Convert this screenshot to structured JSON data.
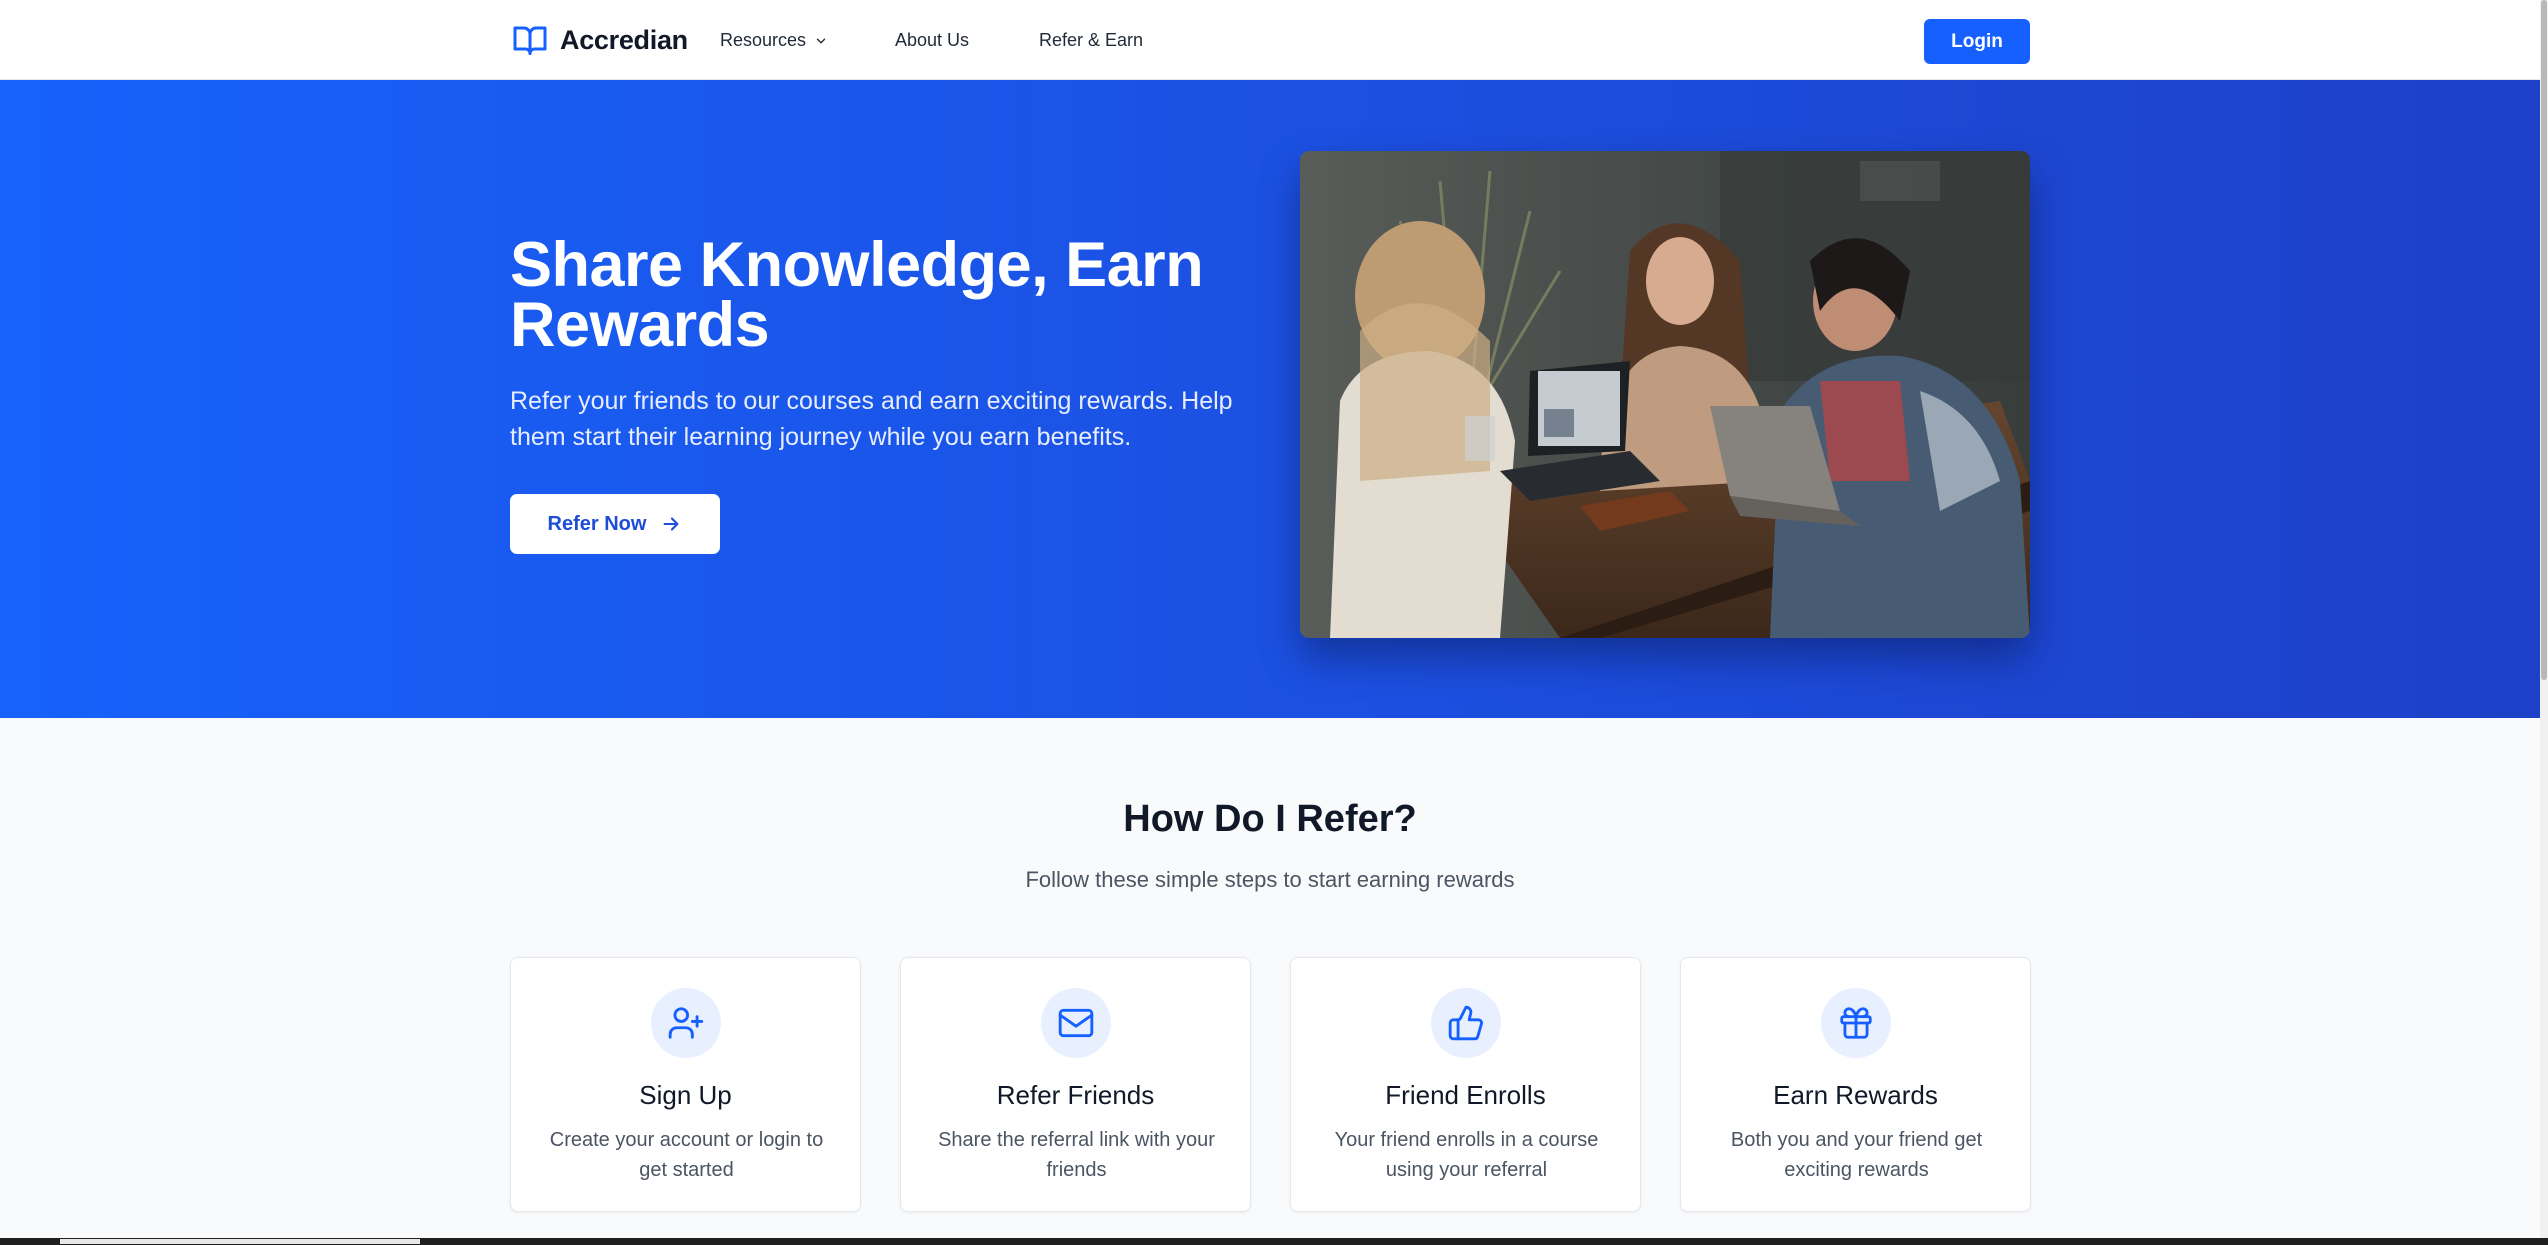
{
  "nav": {
    "logo_text": "Accredian",
    "items": [
      {
        "label": "Resources"
      },
      {
        "label": "About Us"
      },
      {
        "label": "Refer & Earn"
      }
    ],
    "login_label": "Login"
  },
  "hero": {
    "title": "Share Knowledge, Earn Rewards",
    "subtitle": "Refer your friends to our courses and earn exciting rewards. Help them start their learning journey while you earn benefits.",
    "cta_label": "Refer Now"
  },
  "how": {
    "title": "How Do I Refer?",
    "subtitle": "Follow these simple steps to start earning rewards",
    "steps": [
      {
        "icon": "user-plus-icon",
        "title": "Sign Up",
        "desc": "Create your account or login to get started"
      },
      {
        "icon": "mail-icon",
        "title": "Refer Friends",
        "desc": "Share the referral link with your friends"
      },
      {
        "icon": "thumbs-up-icon",
        "title": "Friend Enrolls",
        "desc": "Your friend enrolls in a course using your referral"
      },
      {
        "icon": "gift-icon",
        "title": "Earn Rewards",
        "desc": "Both you and your friend get exciting rewards"
      }
    ]
  },
  "colors": {
    "accent": "#1560ff",
    "hero_start": "#1762fb",
    "hero_end": "#1d40c8",
    "icon_bg": "#e8f0ff"
  }
}
